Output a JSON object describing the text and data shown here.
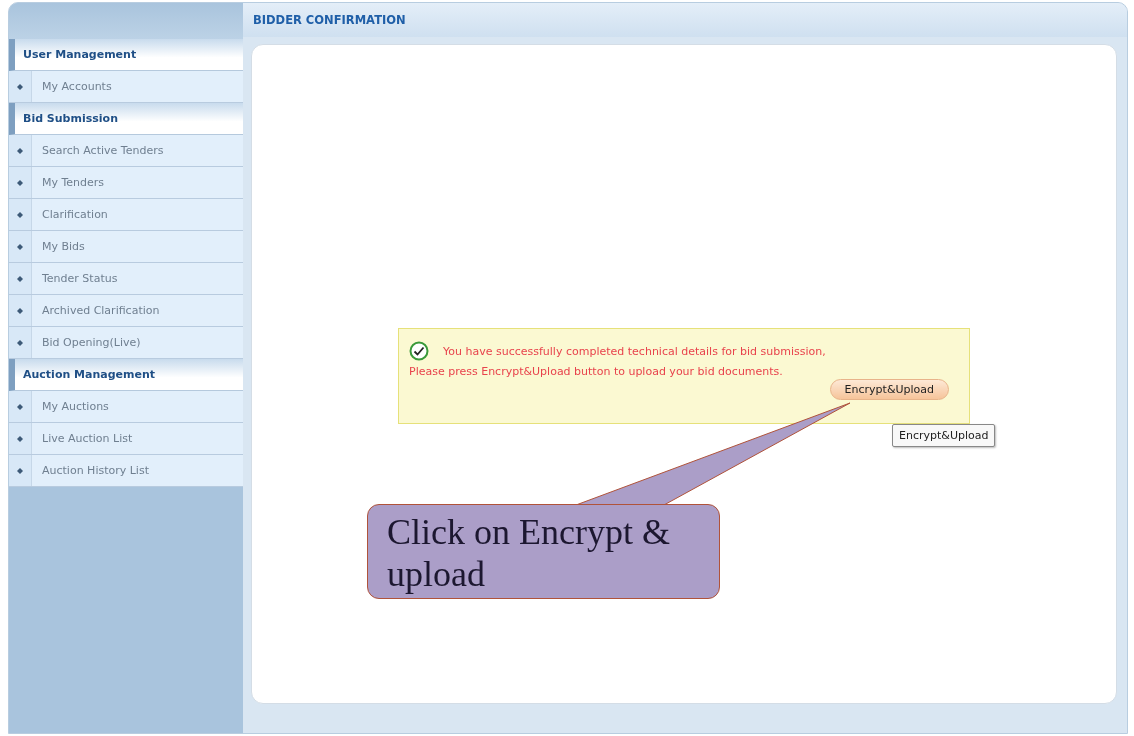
{
  "page_title": "BIDDER CONFIRMATION",
  "sidebar": {
    "sections": [
      {
        "title": "User Management",
        "items": [
          {
            "label": "My Accounts"
          }
        ]
      },
      {
        "title": "Bid Submission",
        "items": [
          {
            "label": "Search Active Tenders"
          },
          {
            "label": "My Tenders"
          },
          {
            "label": "Clarification"
          },
          {
            "label": "My Bids"
          },
          {
            "label": "Tender Status"
          },
          {
            "label": "Archived Clarification"
          },
          {
            "label": "Bid Opening(Live)"
          }
        ]
      },
      {
        "title": "Auction Management",
        "items": [
          {
            "label": "My Auctions"
          },
          {
            "label": "Live Auction List"
          },
          {
            "label": "Auction History List"
          }
        ]
      }
    ]
  },
  "message": {
    "line_1": "You have successfully completed technical details for bid submission,",
    "line_2": "Please press Encrypt&Upload button to upload your bid documents.",
    "button": "Encrypt&Upload"
  },
  "tooltip": "Encrypt&Upload",
  "callout": "Click on Encrypt & upload"
}
